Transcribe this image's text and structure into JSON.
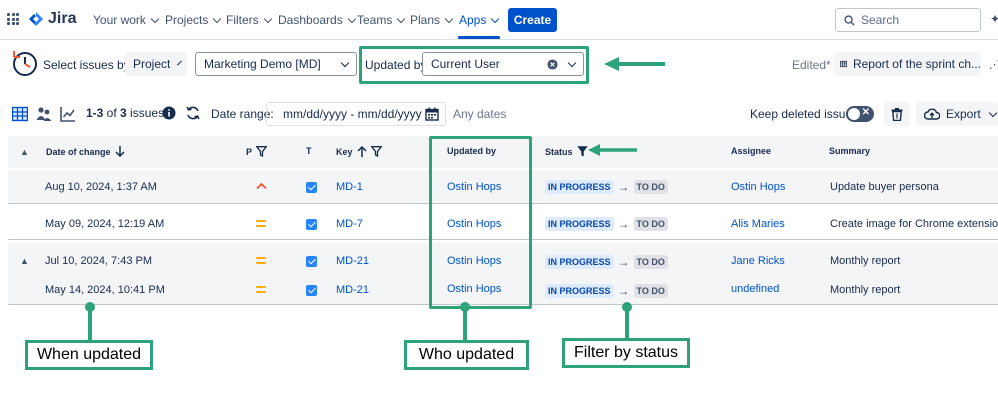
{
  "nav": {
    "logo": "Jira",
    "items": [
      {
        "label": "Your work"
      },
      {
        "label": "Projects"
      },
      {
        "label": "Filters"
      },
      {
        "label": "Dashboards"
      },
      {
        "label": "Teams"
      },
      {
        "label": "Plans"
      },
      {
        "label": "Apps"
      }
    ],
    "create_label": "Create",
    "search_placeholder": "Search"
  },
  "filters": {
    "select_issues_label": "Select issues by:",
    "project_btn": "Project",
    "project_value": "Marketing Demo [MD]",
    "updated_by_label": "Updated by:",
    "updated_by_value": "Current User",
    "edited": "Edited*",
    "report_label": "Report of the sprint ch..."
  },
  "toolbar": {
    "range_prefix": "1-3",
    "of": " of ",
    "total": "3",
    "issues": " issues",
    "date_range_label": "Date range:",
    "date_placeholder": "mm/dd/yyyy - mm/dd/yyyy",
    "any_dates": "Any dates",
    "keep_deleted": "Keep deleted issues",
    "export": "Export"
  },
  "table": {
    "headers": {
      "date": "Date of change",
      "p": "P",
      "t": "T",
      "key": "Key",
      "updated_by": "Updated by",
      "status": "Status",
      "assignee": "Assignee",
      "summary": "Summary"
    },
    "rows": [
      {
        "date": "Aug 10, 2024, 1:37 AM",
        "priority": "high",
        "key": "MD-1",
        "updated_by": "Ostin Hops",
        "from": "IN PROGRESS",
        "to": "TO DO",
        "assignee": "Ostin Hops",
        "summary": "Update buyer persona"
      },
      {
        "date": "May 09, 2024, 12:19 AM",
        "priority": "medium",
        "key": "MD-7",
        "updated_by": "Ostin Hops",
        "from": "IN PROGRESS",
        "to": "TO DO",
        "assignee": "Alis Maries",
        "summary": "Create image for Chrome extension"
      },
      {
        "date": "Jul 10, 2024, 7:43 PM",
        "priority": "medium",
        "key": "MD-21",
        "updated_by": "Ostin Hops",
        "from": "IN PROGRESS",
        "to": "TO DO",
        "assignee": "Jane Ricks",
        "summary": "Monthly report"
      },
      {
        "date": "May 14, 2024, 10:41 PM",
        "priority": "medium",
        "key": "MD-21",
        "updated_by": "Ostin Hops",
        "from": "IN PROGRESS",
        "to": "TO DO",
        "assignee": "undefined",
        "summary": "Monthly report"
      }
    ]
  },
  "annotations": {
    "when_updated": "When updated",
    "who_updated": "Who updated",
    "filter_by_status": "Filter by status"
  },
  "colors": {
    "brand": "#0052cc",
    "annotation_green": "#2ea37a",
    "priority_high": "#ff5630",
    "priority_medium": "#ffab00"
  }
}
